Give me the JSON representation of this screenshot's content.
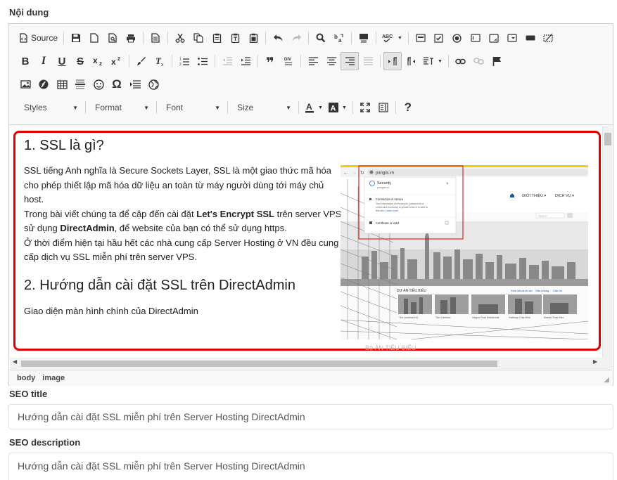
{
  "labels": {
    "content": "Nội dung",
    "seo_title": "SEO title",
    "seo_description": "SEO description"
  },
  "toolbar": {
    "source_label": "Source",
    "styles_label": "Styles",
    "format_label": "Format",
    "font_label": "Font",
    "size_label": "Size"
  },
  "content": {
    "heading1": "1. SSL là gì?",
    "para_lines": [
      "SSL tiếng Anh nghĩa là Secure Sockets Layer, SSL là một giao thức mã hóa cho phép thiết lập mã hóa dữ liệu an toàn từ máy người dùng  tới máy chủ host.",
      "Trong bài viết chúng ta để cập đến cài đặt Let's Encrypt SSL trên server VPS sử dụng DirectAdmin, để website của bạn có thể sử dụng https.",
      "Ở thời điểm hiện tại hầu hết các nhà cung cấp Server Hosting ở VN đều cung cấp dịch vụ SSL miễn phí trên server VPS."
    ],
    "para_text_1": "SSL tiếng Anh nghĩa là Secure Sockets Layer, SSL là một giao thức mã hóa cho phép thiết lập mã hóa dữ liệu an toàn từ máy người dùng  tới máy chủ host.",
    "para_text_2a": "Trong bài viết chúng ta để cập đến cài đặt ",
    "para_text_2b": "Let's Encrypt SSL",
    "para_text_2c": " trên server VPS sử dụng ",
    "para_text_2d": "DirectAdmin",
    "para_text_2e": ", để website của bạn có thể sử dụng https.",
    "para_text_3": "Ở thời điểm hiện tại hầu hết các nhà cung cấp Server Hosting ở VN đều cung cấp dịch vụ SSL miễn phí trên server VPS.",
    "heading2": "2. Hướng dẫn cài đặt SSL trên DirectAdmin",
    "para2": "Giao diện màn hình chính của DirectAdmin",
    "caption": "Bộ ÁN TIÊU BIỂU"
  },
  "screenshot": {
    "url": "pangia.vn",
    "popup_title": "Security",
    "popup_sub": "pangia.vn",
    "popup_line1": "Connection is secure",
    "popup_line2": "Your information (for example, passwords or credit card numbers) is private when it is sent to this site.",
    "popup_link": "Learn more",
    "popup_line3": "Certificate is valid",
    "nav1": "GIỚI THIỆU ▾",
    "nav2": "DỊCH VỤ ▾",
    "search_placeholder": "Search",
    "section_label": "DỰ ÁN TIÊU BIỂU",
    "thumb_caption_1": "The Landmark 81",
    "thumb_caption_2": "The Goldview",
    "thumb_caption_3": "Saigon Pearl Residential",
    "thumb_caption_4": "Gateway Thảo Điền",
    "thumb_caption_5": "Masteri Thảo Điền",
    "more_link_1": "Xem tất cả dự án",
    "more_link_2": "Văn phòng",
    "more_link_3": "Căn hộ"
  },
  "path": {
    "item1": "body",
    "item2": "image"
  },
  "seo": {
    "title_value": "Hướng dẫn cài đặt SSL miễn phí trên Server Hosting DirectAdmin",
    "description_value": "Hướng dẫn cài đặt SSL miễn phí trên Server Hosting DirectAdmin"
  },
  "colors": {
    "highlight_border": "#e00000",
    "toolbar_bg": "#f8f8f8"
  }
}
